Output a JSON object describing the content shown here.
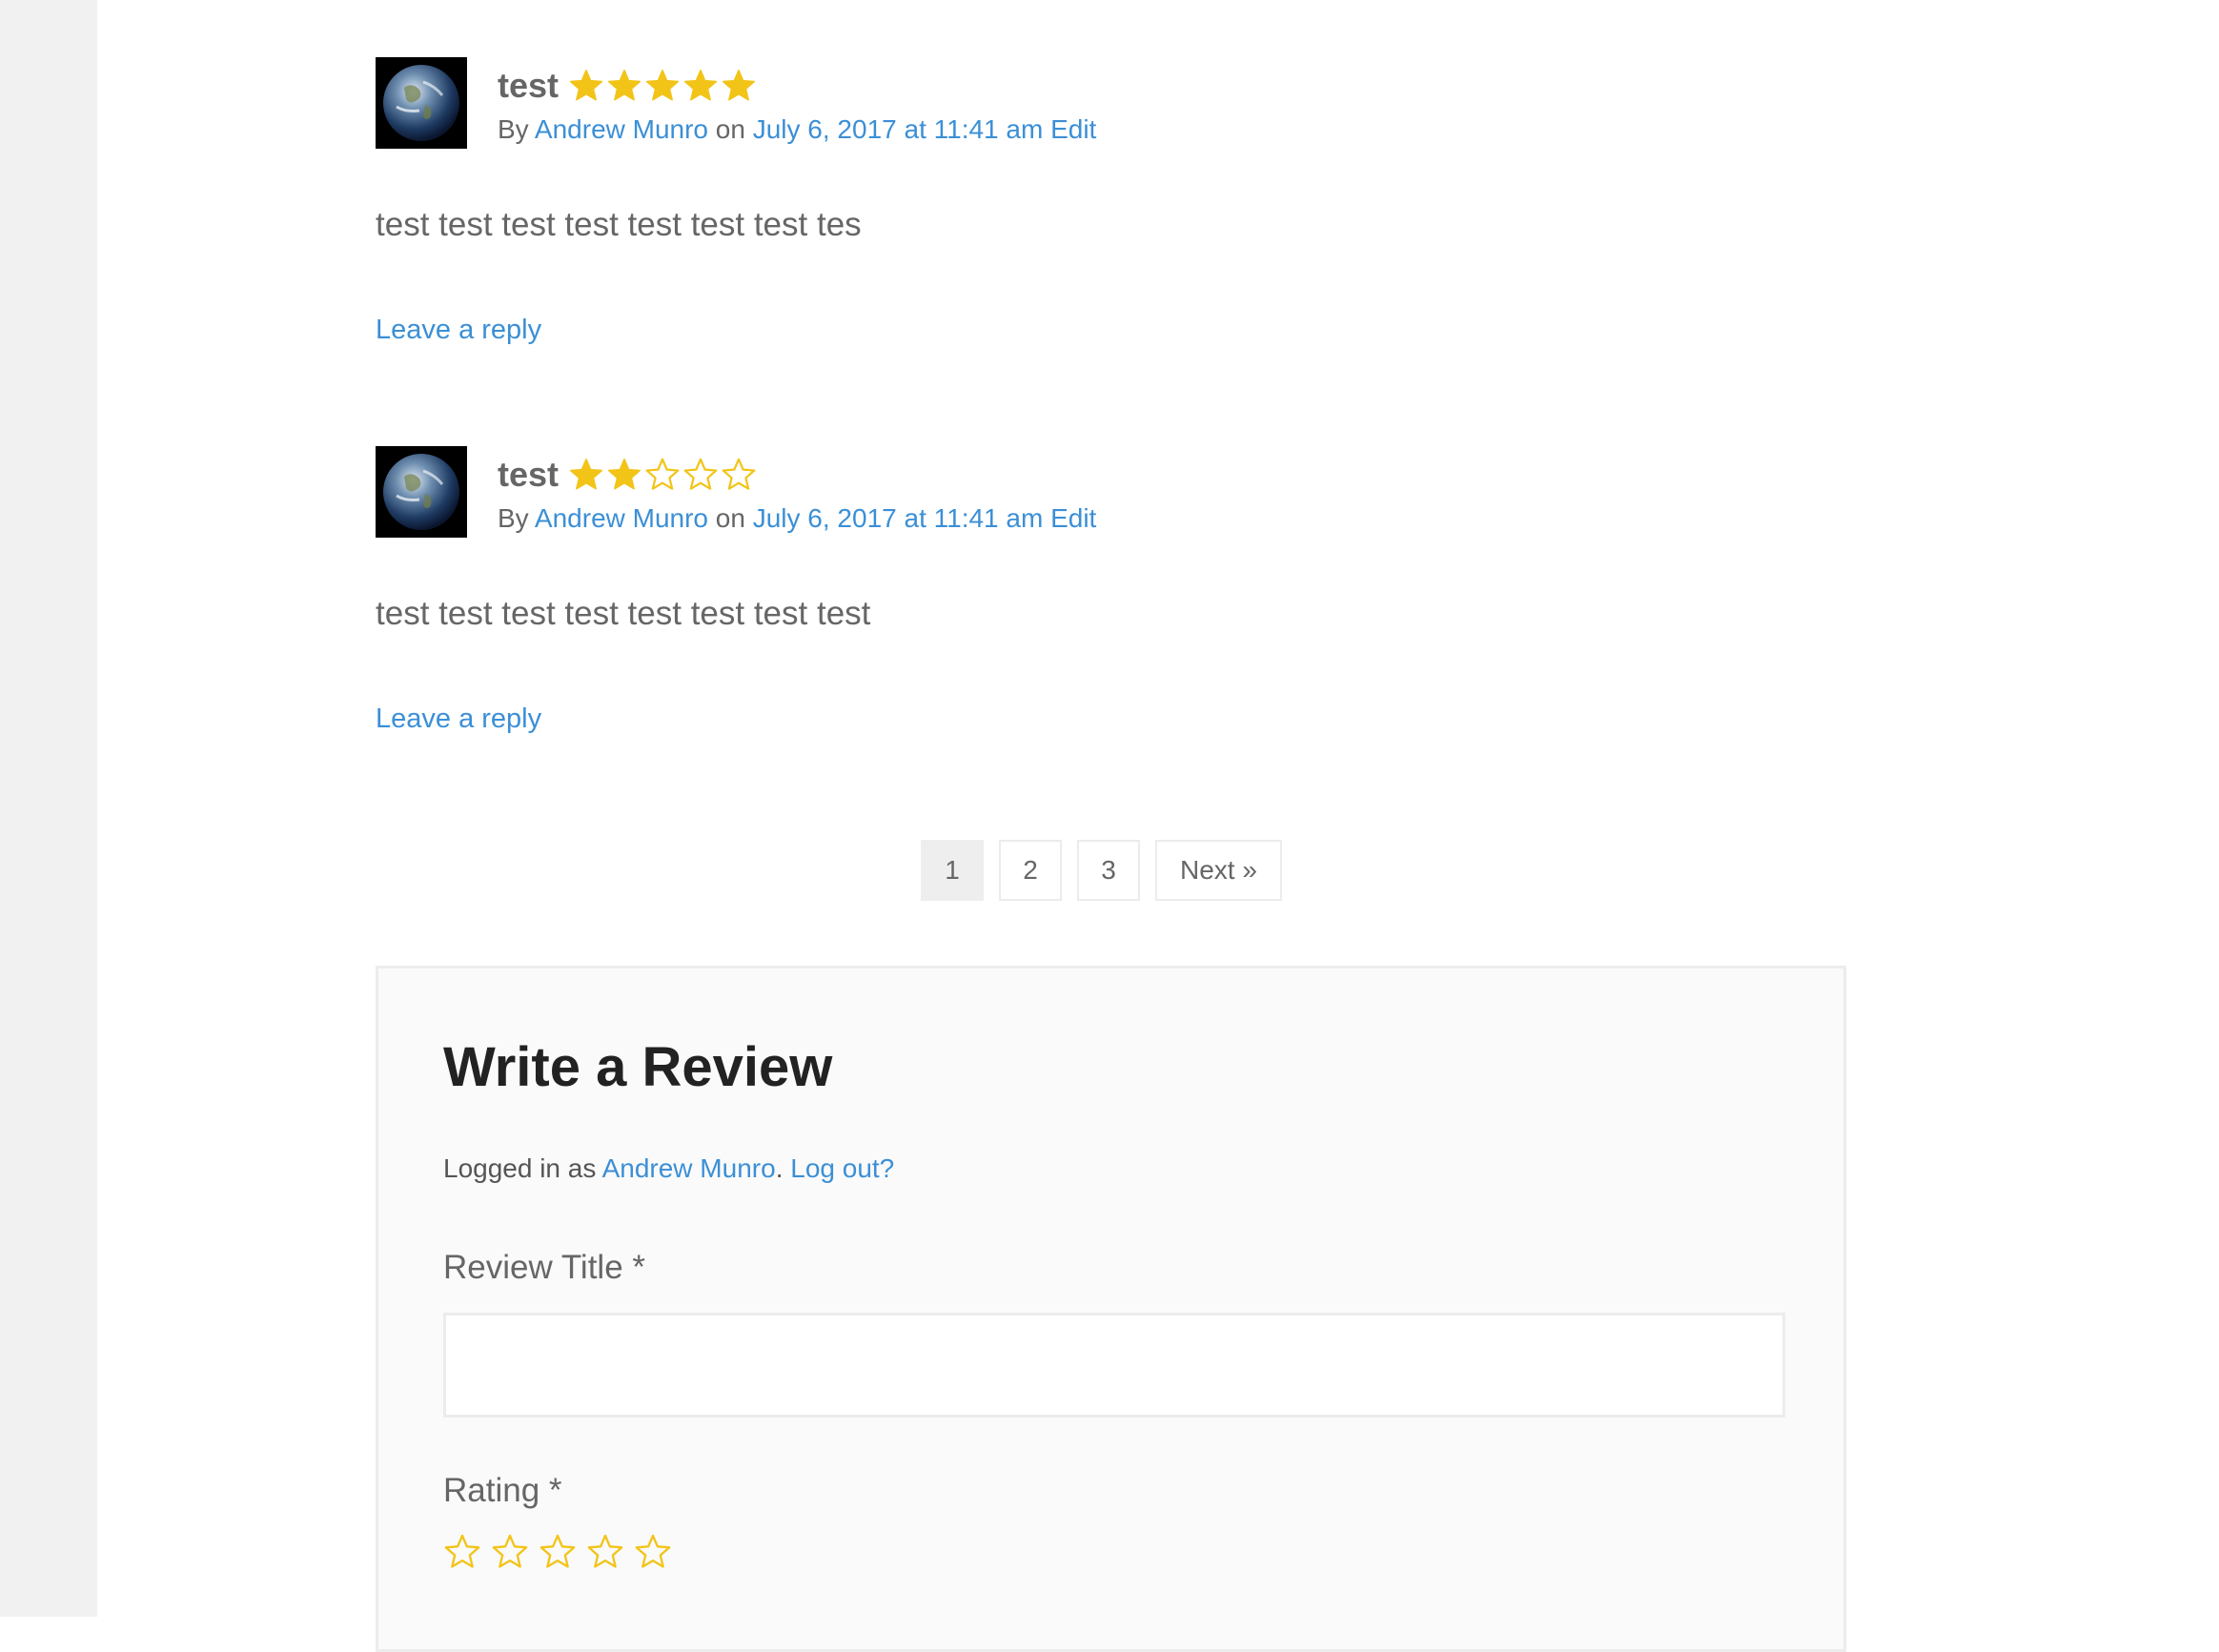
{
  "reviews": [
    {
      "title": "test",
      "rating": 5,
      "by_prefix": "By ",
      "author": "Andrew Munro",
      "on_word": " on ",
      "date": "July 6, 2017 at 11:41 am",
      "edit": "Edit",
      "body": "test test test test test test test tes",
      "reply": "Leave a reply"
    },
    {
      "title": "test",
      "rating": 2,
      "by_prefix": "By ",
      "author": "Andrew Munro",
      "on_word": " on ",
      "date": "July 6, 2017 at 11:41 am",
      "edit": "Edit",
      "body": "test test test test test test test test",
      "reply": "Leave a reply"
    }
  ],
  "pagination": {
    "pages": [
      "1",
      "2",
      "3"
    ],
    "current": "1",
    "next": "Next »"
  },
  "write_review": {
    "heading": "Write a Review",
    "logged_in_prefix": "Logged in as ",
    "user": "Andrew Munro",
    "separator": ".",
    "logout": "Log out?",
    "title_label": "Review Title *",
    "title_value": "",
    "rating_label": "Rating *",
    "rating_value": 0
  },
  "colors": {
    "link": "#3b8fd6",
    "star": "#f2c418",
    "text": "#666666",
    "heading": "#222222"
  },
  "icons": {
    "avatar": "earth-avatar-image",
    "star_filled": "star-filled-icon",
    "star_empty": "star-outline-icon"
  }
}
